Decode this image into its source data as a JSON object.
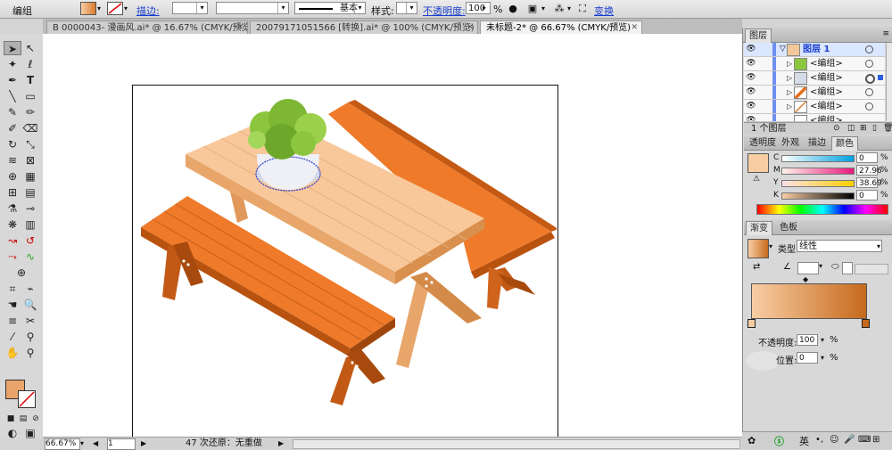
{
  "control_bar": {
    "object_label": "编组",
    "stroke_label": "描边:",
    "stroke_style": "基本",
    "style_label": "样式:",
    "opacity_label": "不透明度:",
    "opacity_value": "100",
    "opacity_unit": "%",
    "transform_label": "变换"
  },
  "tabs": [
    {
      "label": "B 0000043- 漫画风.ai* @ 16.67% (CMYK/预览)",
      "close": "✕"
    },
    {
      "label": "20079171051566 [转换].ai* @ 100% (CMYK/预览)",
      "close": "✕"
    },
    {
      "label": "未标题-2* @ 66.67% (CMYK/预览)",
      "close": "✕"
    }
  ],
  "layers_panel": {
    "title": "图层",
    "layers": [
      {
        "name": "图层 1",
        "icon": "layer-thumb"
      },
      {
        "name": "<编组>",
        "icon": "group-thumb"
      },
      {
        "name": "<编组>",
        "icon": "group-thumb"
      },
      {
        "name": "<编组>",
        "icon": "group-thumb"
      },
      {
        "name": "<编组>",
        "icon": "group-thumb"
      },
      {
        "name": "<编组>",
        "icon": "group-thumb"
      }
    ],
    "footer": "1 个图层"
  },
  "color_panel": {
    "tabs": [
      "透明度",
      "外观",
      "描边",
      "颜色"
    ],
    "channels": [
      {
        "label": "C",
        "value": "0",
        "unit": "%"
      },
      {
        "label": "M",
        "value": "27.96",
        "unit": "%"
      },
      {
        "label": "Y",
        "value": "38.69",
        "unit": "%"
      },
      {
        "label": "K",
        "value": "0",
        "unit": "%"
      }
    ],
    "fill_color": "#f8cda4"
  },
  "gradient_panel": {
    "tabs": [
      "渐变",
      "色板"
    ],
    "type_label": "类型:",
    "type_value": "线性",
    "opacity_label": "不透明度:",
    "opacity_value": "100",
    "location_label": "位置:",
    "location_value": "0",
    "unit": "%",
    "gradient_start": "#f8cda4",
    "gradient_end": "#c66a1c"
  },
  "status_bar": {
    "zoom": "66.67%",
    "page": "1",
    "status_text": "47 次还原：无重做"
  },
  "taskbar": {
    "ime_label": "英"
  },
  "colors": {
    "fill_swatch": "#e8a46a",
    "table_top": "#f8c79a",
    "bench_orange": "#e8701e",
    "plant_green": "#8cc63f"
  }
}
